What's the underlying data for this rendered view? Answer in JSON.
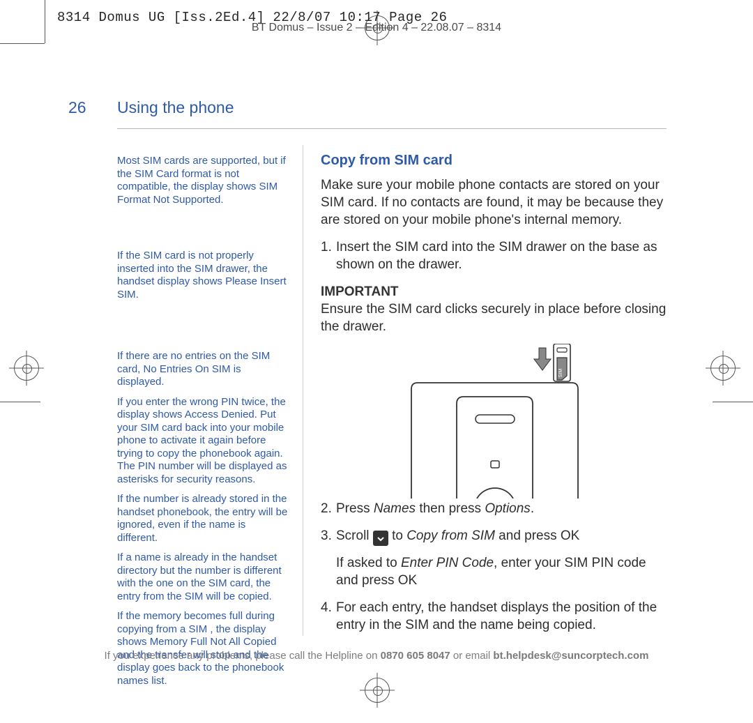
{
  "print_header": "8314 Domus UG [Iss.2Ed.4]  22/8/07  10:17  Page 26",
  "running_title": "BT Domus – Issue 2 – Edition 4 – 22.08.07 – 8314",
  "page_number": "26",
  "page_heading": "Using the phone",
  "side_notes": {
    "n1_a": "Most SIM cards are supported, but if the SIM Card format is not compatible, the display shows ",
    "n1_styled": "SIM Format Not Supported",
    "n1_b": ".",
    "n2_a": "If the SIM card is not properly inserted into the SIM drawer, the handset display shows ",
    "n2_styled": "Please Insert SIM",
    "n2_b": ".",
    "n3_a": "If there are no entries on the SIM card, ",
    "n3_styled": "No Entries On SIM",
    "n3_b": " is displayed.",
    "n4_a": "If you enter the wrong PIN twice, the display shows ",
    "n4_styled": "Access Denied",
    "n4_b": ". Put your SIM card back into your mobile phone to activate it again before trying to copy the phonebook again. The PIN number will be displayed as asterisks for security reasons.",
    "n5": "If the number is already stored in the handset phonebook, the entry will be ignored, even if the name is different.",
    "n6": "If a name is already in the handset directory but the number is different with the one on the SIM card, the entry from the SIM will be copied.",
    "n7_a": "If the memory becomes full during copying from a SIM , the display shows ",
    "n7_styled": "Memory Full Not All Copied",
    "n7_b": " and the transfer will stop and the display goes back to the phonebook names list."
  },
  "main": {
    "h3": "Copy from SIM card",
    "intro": "Make sure your mobile phone contacts are stored on your SIM card. If no contacts are found, it may be because they are stored on your mobile phone's internal memory.",
    "s1_n": "1.",
    "s1": "Insert the SIM card into the SIM drawer on the base as shown on the drawer.",
    "important_label": "IMPORTANT",
    "important": "Ensure the SIM card clicks securely in place before closing the drawer.",
    "s2_n": "2.",
    "s2_a": "Press ",
    "s2_names": "Names",
    "s2_b": " then press ",
    "s2_options": "Options",
    "s2_c": ".",
    "s3_n": "3.",
    "s3_a": "Scroll ",
    "s3_b": " to ",
    "s3_copy": "Copy from SIM",
    "s3_c": " and press OK",
    "s3_follow_a": "If asked to ",
    "s3_follow_code": "Enter PIN Code",
    "s3_follow_b": ", enter your SIM PIN code and press OK",
    "s4_n": "4.",
    "s4": "For each entry, the handset displays the position of the entry in the SIM and the name being copied.",
    "sim_label": "SIM"
  },
  "helpline": {
    "a": "If you experience any problems, please call the Helpline on ",
    "phone": "0870 605 8047",
    "b": " or email ",
    "email": "bt.helpdesk@suncorptech.com"
  }
}
